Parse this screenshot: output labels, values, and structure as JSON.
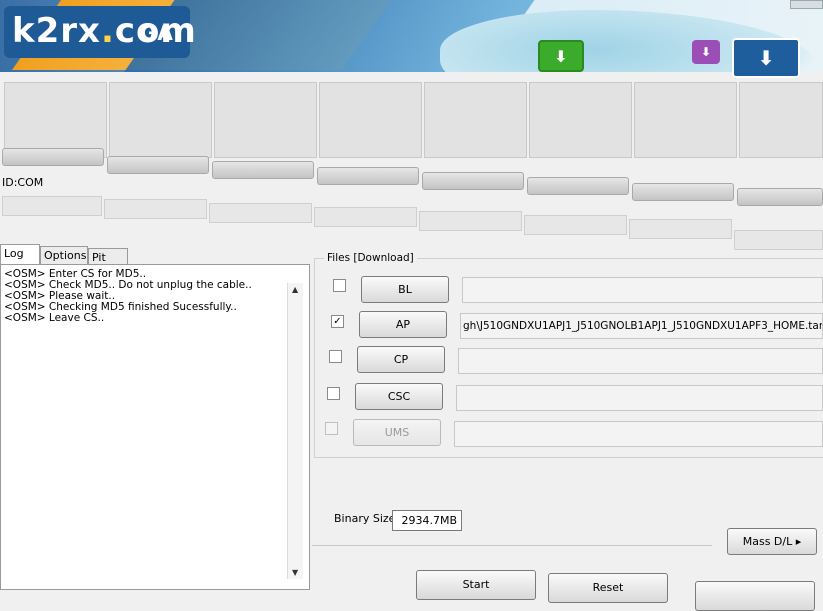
{
  "logo": {
    "text_main": "k2rx",
    "text_dot": ".",
    "text_tld": "com",
    "text_ga": "GA"
  },
  "banner": {
    "icons": [
      "download-green-icon",
      "download-purple-icon",
      "download-blue-icon"
    ]
  },
  "ports": {
    "id_com_label": "ID:COM"
  },
  "tabs": [
    {
      "label": "Log"
    },
    {
      "label": "Options"
    },
    {
      "label": "Pit"
    }
  ],
  "log": {
    "lines": [
      "<OSM> Enter CS for MD5..",
      "<OSM> Check MD5.. Do not unplug the cable..",
      "<OSM> Please wait..",
      "<OSM> Checking MD5 finished Sucessfully..",
      "<OSM> Leave CS.."
    ]
  },
  "files": {
    "legend": "Files [Download]",
    "rows": [
      {
        "label": "BL",
        "checked": false,
        "enabled": true,
        "path": ""
      },
      {
        "label": "AP",
        "checked": true,
        "enabled": true,
        "path": "gh\\J510GNDXU1APJ1_J510GNOLB1APJ1_J510GNDXU1APF3_HOME.tar.md5"
      },
      {
        "label": "CP",
        "checked": false,
        "enabled": true,
        "path": ""
      },
      {
        "label": "CSC",
        "checked": false,
        "enabled": true,
        "path": ""
      },
      {
        "label": "UMS",
        "checked": false,
        "enabled": false,
        "path": ""
      }
    ]
  },
  "binary": {
    "label": "Binary Size",
    "value": "2934.7MB"
  },
  "buttons": {
    "mass_dl": "Mass D/L ▸",
    "start": "Start",
    "reset": "Reset",
    "exit": ""
  }
}
